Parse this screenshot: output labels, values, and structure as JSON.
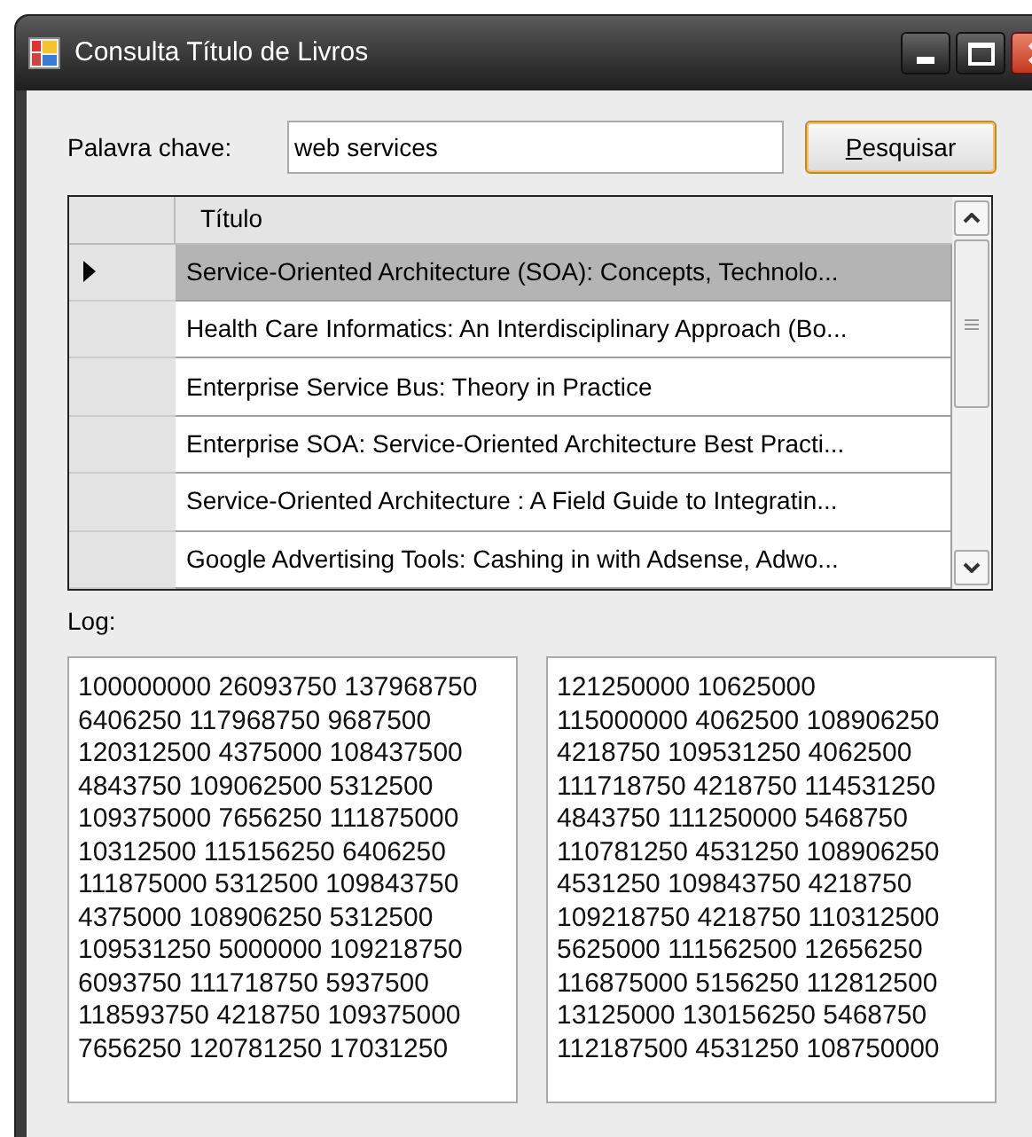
{
  "window": {
    "title": "Consulta Título de Livros"
  },
  "search": {
    "label": "Palavra chave:",
    "value": "web services",
    "button": {
      "mnemonic": "P",
      "rest": "esquisar"
    }
  },
  "grid": {
    "columns": [
      "Título"
    ],
    "rows": [
      {
        "title": "Service-Oriented Architecture (SOA): Concepts, Technolo...",
        "selected": true
      },
      {
        "title": "Health Care Informatics: An Interdisciplinary Approach (Bo...",
        "selected": false
      },
      {
        "title": "Enterprise Service Bus: Theory in Practice",
        "selected": false
      },
      {
        "title": "Enterprise SOA: Service-Oriented Architecture Best Practi...",
        "selected": false
      },
      {
        "title": "Service-Oriented Architecture : A Field Guide to Integratin...",
        "selected": false
      },
      {
        "title": "Google Advertising Tools: Cashing in with Adsense, Adwo...",
        "selected": false
      }
    ]
  },
  "log": {
    "label": "Log:",
    "boxes": [
      {
        "lines": [
          "100000000 26093750 137968750",
          "6406250 117968750 9687500",
          "120312500 4375000 108437500",
          "4843750 109062500 5312500",
          "109375000 7656250 111875000",
          "10312500 115156250 6406250",
          "111875000 5312500 109843750",
          "4375000 108906250 5312500",
          "109531250 5000000 109218750",
          "6093750 111718750 5937500",
          "118593750 4218750 109375000",
          "7656250 120781250 17031250"
        ]
      },
      {
        "lines": [
          "121250000 10625000",
          "115000000 4062500 108906250",
          "4218750 109531250 4062500",
          "111718750 4218750 114531250",
          "4843750 111250000 5468750",
          "110781250 4531250 108906250",
          "4531250 109843750 4218750",
          "109218750 4218750 110312500",
          "5625000 111562500 12656250",
          "116875000 5156250 112812500",
          "13125000 130156250 5468750",
          "112187500 4531250 108750000"
        ]
      }
    ]
  }
}
